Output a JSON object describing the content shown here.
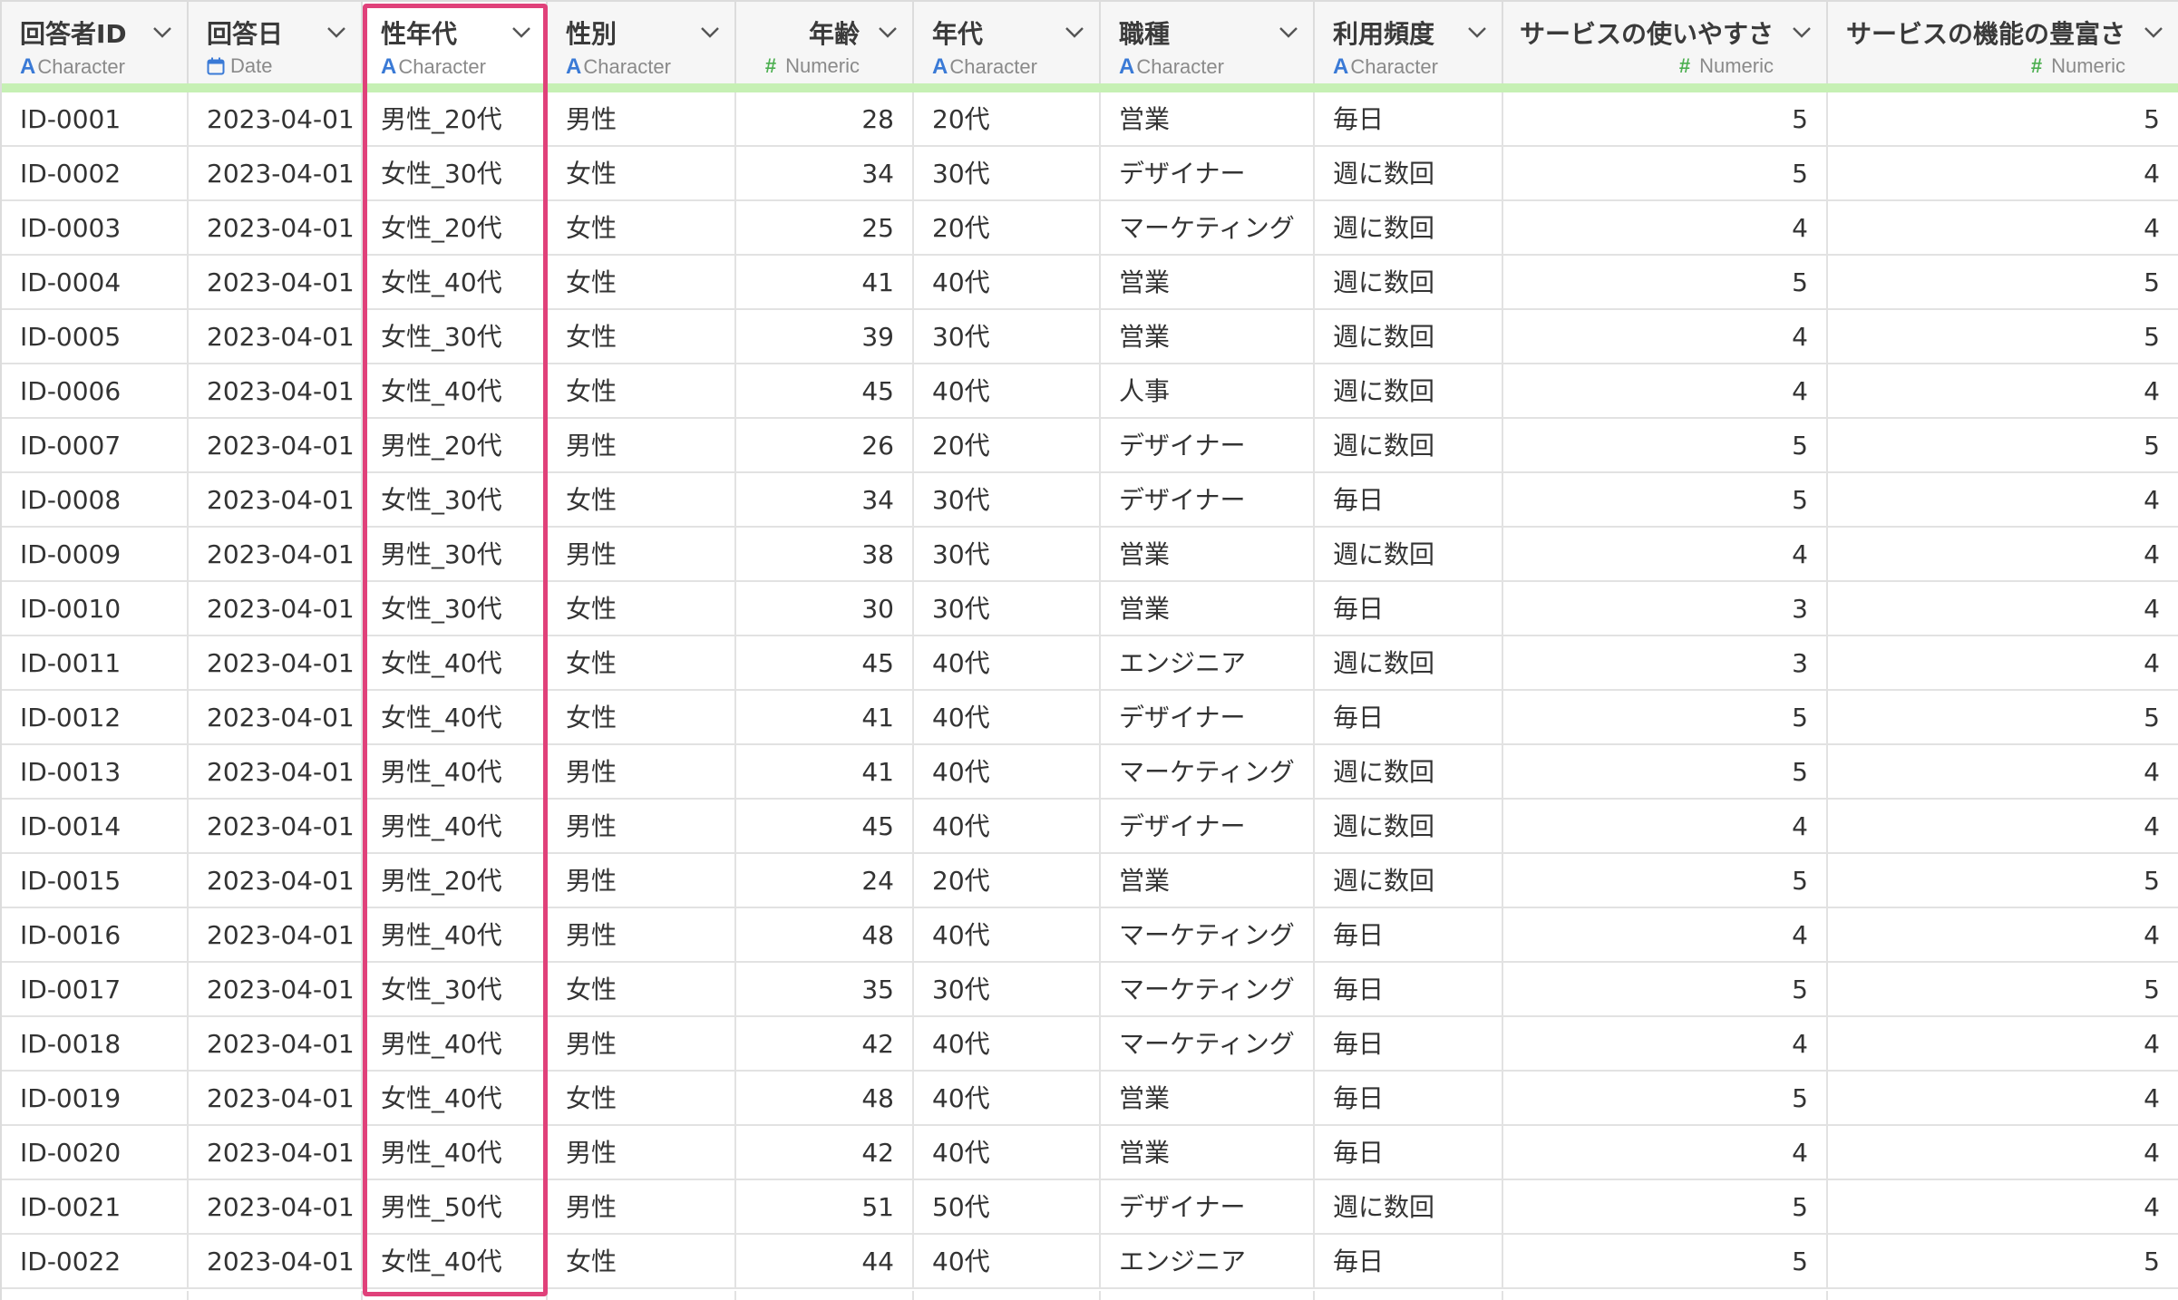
{
  "columns": [
    {
      "name": "回答者ID",
      "type": "Character",
      "type_icon": "character-type-icon"
    },
    {
      "name": "回答日",
      "type": "Date",
      "type_icon": "calendar-icon"
    },
    {
      "name": "性年代",
      "type": "Character",
      "type_icon": "character-type-icon"
    },
    {
      "name": "性別",
      "type": "Character",
      "type_icon": "character-type-icon"
    },
    {
      "name": "年齢",
      "type": "Numeric",
      "type_icon": "numeric-type-icon"
    },
    {
      "name": "年代",
      "type": "Character",
      "type_icon": "character-type-icon"
    },
    {
      "name": "職種",
      "type": "Character",
      "type_icon": "character-type-icon"
    },
    {
      "name": "利用頻度",
      "type": "Character",
      "type_icon": "character-type-icon"
    },
    {
      "name": "サービスの使いやすさ",
      "type": "Numeric",
      "type_icon": "numeric-type-icon"
    },
    {
      "name": "サービスの機能の豊富さ",
      "type": "Numeric",
      "type_icon": "numeric-type-icon"
    }
  ],
  "type_glyphs": {
    "character": "A",
    "numeric": "#"
  },
  "highlighted_column": "性年代",
  "colors": {
    "highlight": "#e0417a",
    "header_underline": "#c6f0b4",
    "character_icon": "#3a7ad6",
    "numeric_icon": "#4caf50"
  },
  "rows": [
    [
      "ID-0001",
      "2023-04-01",
      "男性_20代",
      "男性",
      "28",
      "20代",
      "営業",
      "毎日",
      "5",
      "5"
    ],
    [
      "ID-0002",
      "2023-04-01",
      "女性_30代",
      "女性",
      "34",
      "30代",
      "デザイナー",
      "週に数回",
      "5",
      "4"
    ],
    [
      "ID-0003",
      "2023-04-01",
      "女性_20代",
      "女性",
      "25",
      "20代",
      "マーケティング",
      "週に数回",
      "4",
      "4"
    ],
    [
      "ID-0004",
      "2023-04-01",
      "女性_40代",
      "女性",
      "41",
      "40代",
      "営業",
      "週に数回",
      "5",
      "5"
    ],
    [
      "ID-0005",
      "2023-04-01",
      "女性_30代",
      "女性",
      "39",
      "30代",
      "営業",
      "週に数回",
      "4",
      "5"
    ],
    [
      "ID-0006",
      "2023-04-01",
      "女性_40代",
      "女性",
      "45",
      "40代",
      "人事",
      "週に数回",
      "4",
      "4"
    ],
    [
      "ID-0007",
      "2023-04-01",
      "男性_20代",
      "男性",
      "26",
      "20代",
      "デザイナー",
      "週に数回",
      "5",
      "5"
    ],
    [
      "ID-0008",
      "2023-04-01",
      "女性_30代",
      "女性",
      "34",
      "30代",
      "デザイナー",
      "毎日",
      "5",
      "4"
    ],
    [
      "ID-0009",
      "2023-04-01",
      "男性_30代",
      "男性",
      "38",
      "30代",
      "営業",
      "週に数回",
      "4",
      "4"
    ],
    [
      "ID-0010",
      "2023-04-01",
      "女性_30代",
      "女性",
      "30",
      "30代",
      "営業",
      "毎日",
      "3",
      "4"
    ],
    [
      "ID-0011",
      "2023-04-01",
      "女性_40代",
      "女性",
      "45",
      "40代",
      "エンジニア",
      "週に数回",
      "3",
      "4"
    ],
    [
      "ID-0012",
      "2023-04-01",
      "女性_40代",
      "女性",
      "41",
      "40代",
      "デザイナー",
      "毎日",
      "5",
      "5"
    ],
    [
      "ID-0013",
      "2023-04-01",
      "男性_40代",
      "男性",
      "41",
      "40代",
      "マーケティング",
      "週に数回",
      "5",
      "4"
    ],
    [
      "ID-0014",
      "2023-04-01",
      "男性_40代",
      "男性",
      "45",
      "40代",
      "デザイナー",
      "週に数回",
      "4",
      "4"
    ],
    [
      "ID-0015",
      "2023-04-01",
      "男性_20代",
      "男性",
      "24",
      "20代",
      "営業",
      "週に数回",
      "5",
      "5"
    ],
    [
      "ID-0016",
      "2023-04-01",
      "男性_40代",
      "男性",
      "48",
      "40代",
      "マーケティング",
      "毎日",
      "4",
      "4"
    ],
    [
      "ID-0017",
      "2023-04-01",
      "女性_30代",
      "女性",
      "35",
      "30代",
      "マーケティング",
      "毎日",
      "5",
      "5"
    ],
    [
      "ID-0018",
      "2023-04-01",
      "男性_40代",
      "男性",
      "42",
      "40代",
      "マーケティング",
      "毎日",
      "4",
      "4"
    ],
    [
      "ID-0019",
      "2023-04-01",
      "女性_40代",
      "女性",
      "48",
      "40代",
      "営業",
      "毎日",
      "5",
      "4"
    ],
    [
      "ID-0020",
      "2023-04-01",
      "男性_40代",
      "男性",
      "42",
      "40代",
      "営業",
      "毎日",
      "4",
      "4"
    ],
    [
      "ID-0021",
      "2023-04-01",
      "男性_50代",
      "男性",
      "51",
      "50代",
      "デザイナー",
      "週に数回",
      "5",
      "4"
    ],
    [
      "ID-0022",
      "2023-04-01",
      "女性_40代",
      "女性",
      "44",
      "40代",
      "エンジニア",
      "毎日",
      "5",
      "5"
    ]
  ]
}
